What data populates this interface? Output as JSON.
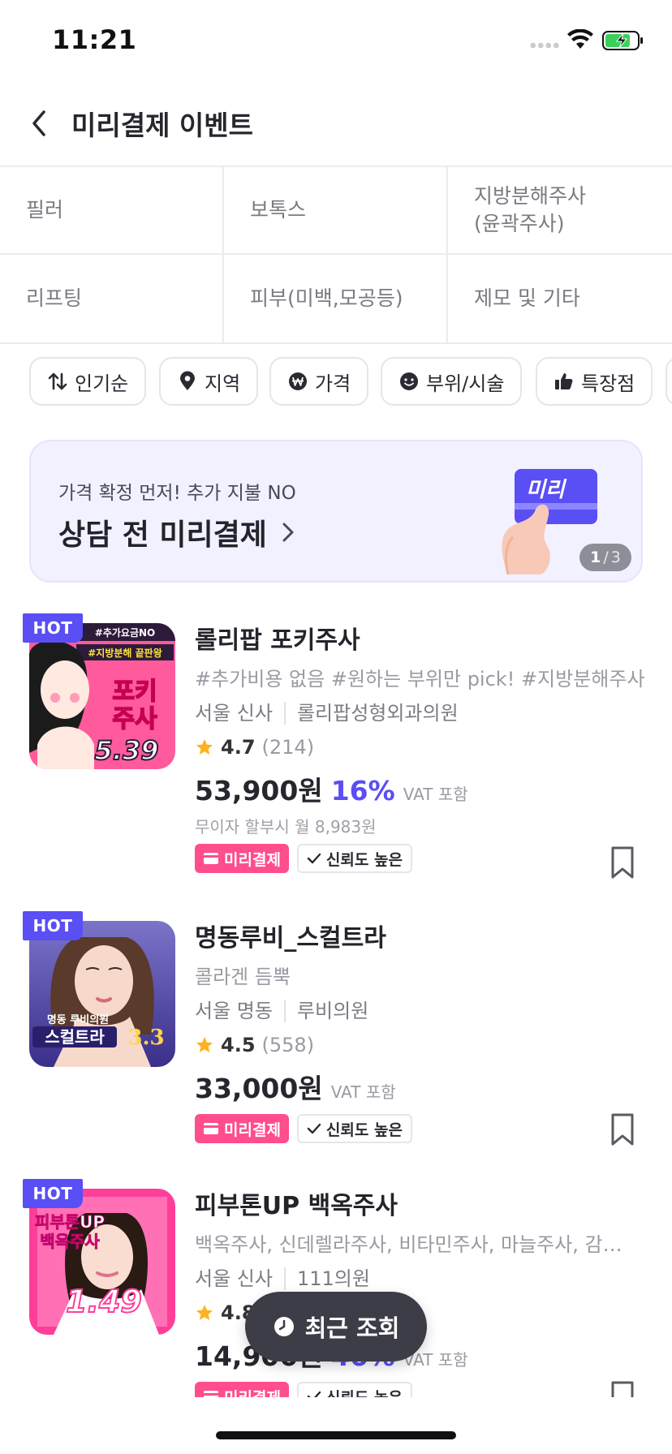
{
  "status_bar": {
    "time": "11:21"
  },
  "header": {
    "title": "미리결제 이벤트"
  },
  "categories": [
    [
      "필러",
      "보톡스",
      "지방분해주사\n(윤곽주사)"
    ],
    [
      "리프팅",
      "피부(미백,모공등)",
      "제모 및 기타"
    ]
  ],
  "filters": [
    {
      "label": "인기순",
      "icon": "sort-icon"
    },
    {
      "label": "지역",
      "icon": "location-pin-icon"
    },
    {
      "label": "가격",
      "icon": "won-icon"
    },
    {
      "label": "부위/시술",
      "icon": "face-icon"
    },
    {
      "label": "특장점",
      "icon": "thumbs-up-icon"
    }
  ],
  "banner": {
    "subtitle": "가격 확정 먼저! 추가 지불 NO",
    "title": "상담 전 미리결제",
    "card_text": "미리",
    "pager_current": "1",
    "pager_total": "3"
  },
  "products": [
    {
      "badge": "HOT",
      "name": "롤리팝 포키주사",
      "tags": "#추가비용 없음 #원하는 부위만 pick! #지방분해주사",
      "location": "서울 신사",
      "clinic": "롤리팝성형외과의원",
      "rating": "4.7",
      "reviews": "(214)",
      "price": "53,900원",
      "discount": "16%",
      "vat": "VAT 포함",
      "installment": "무이자 할부시 월 8,983원",
      "pay_badge": "미리결제",
      "trust_badge": "신뢰도 높은",
      "thumb_lines": [
        "#추가요금NO",
        "#지방분해 끝판왕",
        "포키",
        "주사",
        "5.39"
      ]
    },
    {
      "badge": "HOT",
      "name": "명동루비_스컬트라",
      "tags": "콜라겐 듬뿍",
      "location": "서울 명동",
      "clinic": "루비의원",
      "rating": "4.5",
      "reviews": "(558)",
      "price": "33,000원",
      "vat": "VAT 포함",
      "pay_badge": "미리결제",
      "trust_badge": "신뢰도 높은",
      "thumb_lines": [
        "명동 루비의원",
        "스컬트라",
        "3.3"
      ]
    },
    {
      "badge": "HOT",
      "name": "피부톤UP 백옥주사",
      "tags": "백옥주사, 신데렐라주사, 비타민주사, 마늘주사, 감…",
      "location": "서울 신사",
      "clinic": "111의원",
      "rating": "4.8",
      "price": "14,900원",
      "discount": "46%",
      "vat": "VAT 포함",
      "pay_badge": "미리결제",
      "trust_badge": "신뢰도 높은",
      "thumb_lines": [
        "피부톤UP",
        "백옥주사",
        "1.49"
      ]
    }
  ],
  "floating": {
    "recent_label": "최근 조회"
  },
  "colors": {
    "accent": "#5a4ef5",
    "pay_pink": "#ff4d8d",
    "recent_bg": "#3d3d48"
  }
}
